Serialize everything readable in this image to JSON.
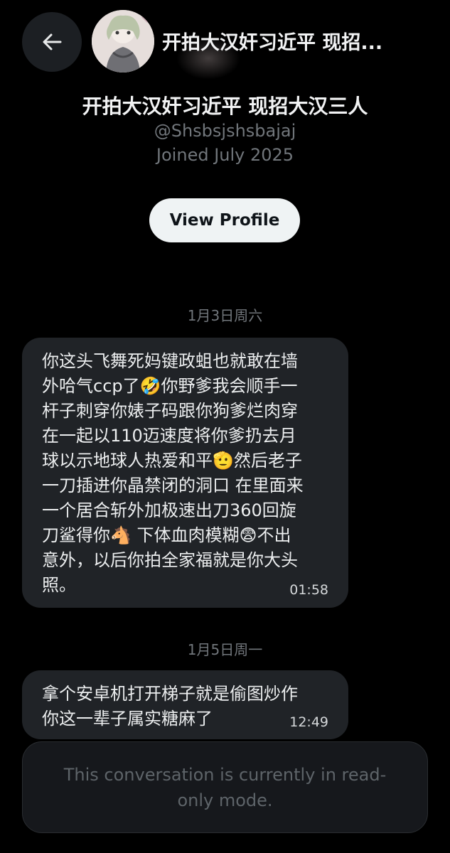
{
  "header": {
    "back_icon": "arrow-left-icon",
    "title": "开拍大汉奸习近平 现招..."
  },
  "profile": {
    "name": "开拍大汉奸习近平 现招大汉三人",
    "handle": "@Shsbsjshsbajaj",
    "joined": "Joined July 2025",
    "view_profile_label": "View Profile"
  },
  "messages": [
    {
      "date": "1月3日周六",
      "lines": [
        "你这头飞舞死妈键政蛆也就敢在墙",
        "外哈气ccp了🤣你野爹我会顺手一",
        "杆子刺穿你婊子码跟你狗爹烂肉穿",
        "在一起以110迈速度将你爹扔去月",
        "球以示地球人热爱和平🫡然后老子",
        "一刀插进你晶禁闭的洞口 在里面来",
        "一个居合斩外加极速出刀360回旋",
        "刀鲨得你🐴 下体血肉模糊😨不出",
        "意外，以后你拍全家福就是你大头",
        "照。"
      ],
      "time": "01:58"
    },
    {
      "date": "1月5日周一",
      "lines": [
        "拿个安卓机打开梯子就是偷图炒作",
        "你这一辈子属实糖麻了"
      ],
      "time": "12:49"
    }
  ],
  "footer": {
    "readonly_text": "This conversation is currently in read-only mode."
  }
}
